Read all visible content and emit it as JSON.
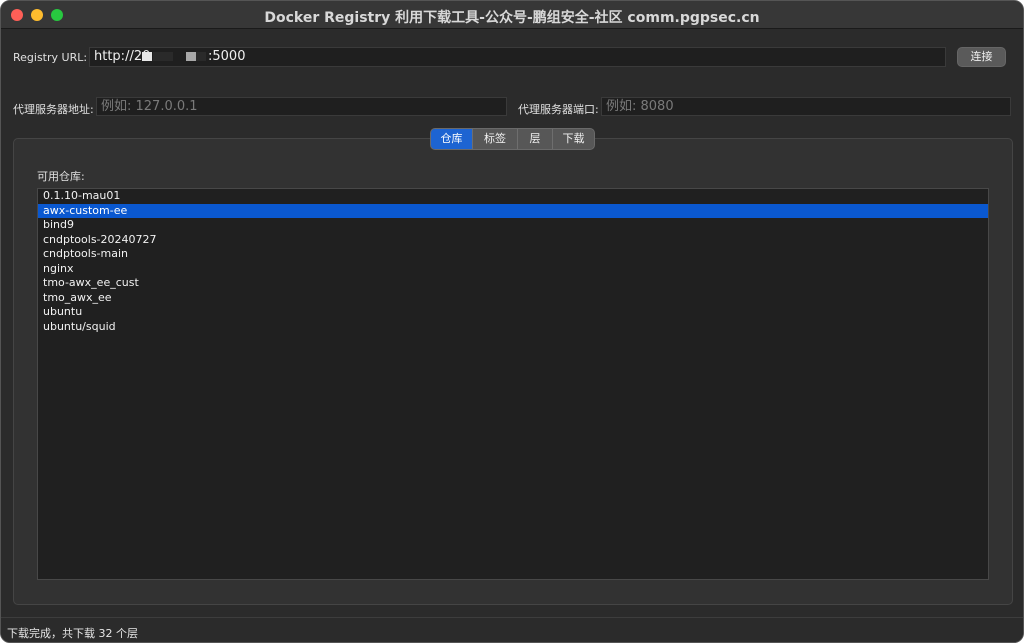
{
  "window": {
    "title": "Docker Registry 利用下载工具-公众号-鹏组安全-社区 comm.pgpsec.cn"
  },
  "registry": {
    "label": "Registry URL:",
    "value_prefix": "http://20",
    "value_suffix": ":5000",
    "connect_label": "连接"
  },
  "proxy": {
    "address_label": "代理服务器地址:",
    "address_placeholder": "例如: 127.0.0.1",
    "port_label": "代理服务器端口:",
    "port_placeholder": "例如: 8080"
  },
  "tabs": [
    {
      "label": "仓库",
      "active": true
    },
    {
      "label": "标签",
      "active": false
    },
    {
      "label": "层",
      "active": false
    },
    {
      "label": "下载",
      "active": false
    }
  ],
  "repositories": {
    "heading": "可用仓库:",
    "items": [
      "0.1.10-mau01",
      "awx-custom-ee",
      "bind9",
      "cndptools-20240727",
      "cndptools-main",
      "nginx",
      "tmo-awx_ee_cust",
      "tmo_awx_ee",
      "ubuntu",
      "ubuntu/squid"
    ],
    "selected_index": 1
  },
  "status": {
    "text": "下载完成，共下载 32 个层"
  },
  "colors": {
    "accent": "#1d64d2",
    "selection": "#0a58d0",
    "window_bg": "#2b2b2b"
  }
}
